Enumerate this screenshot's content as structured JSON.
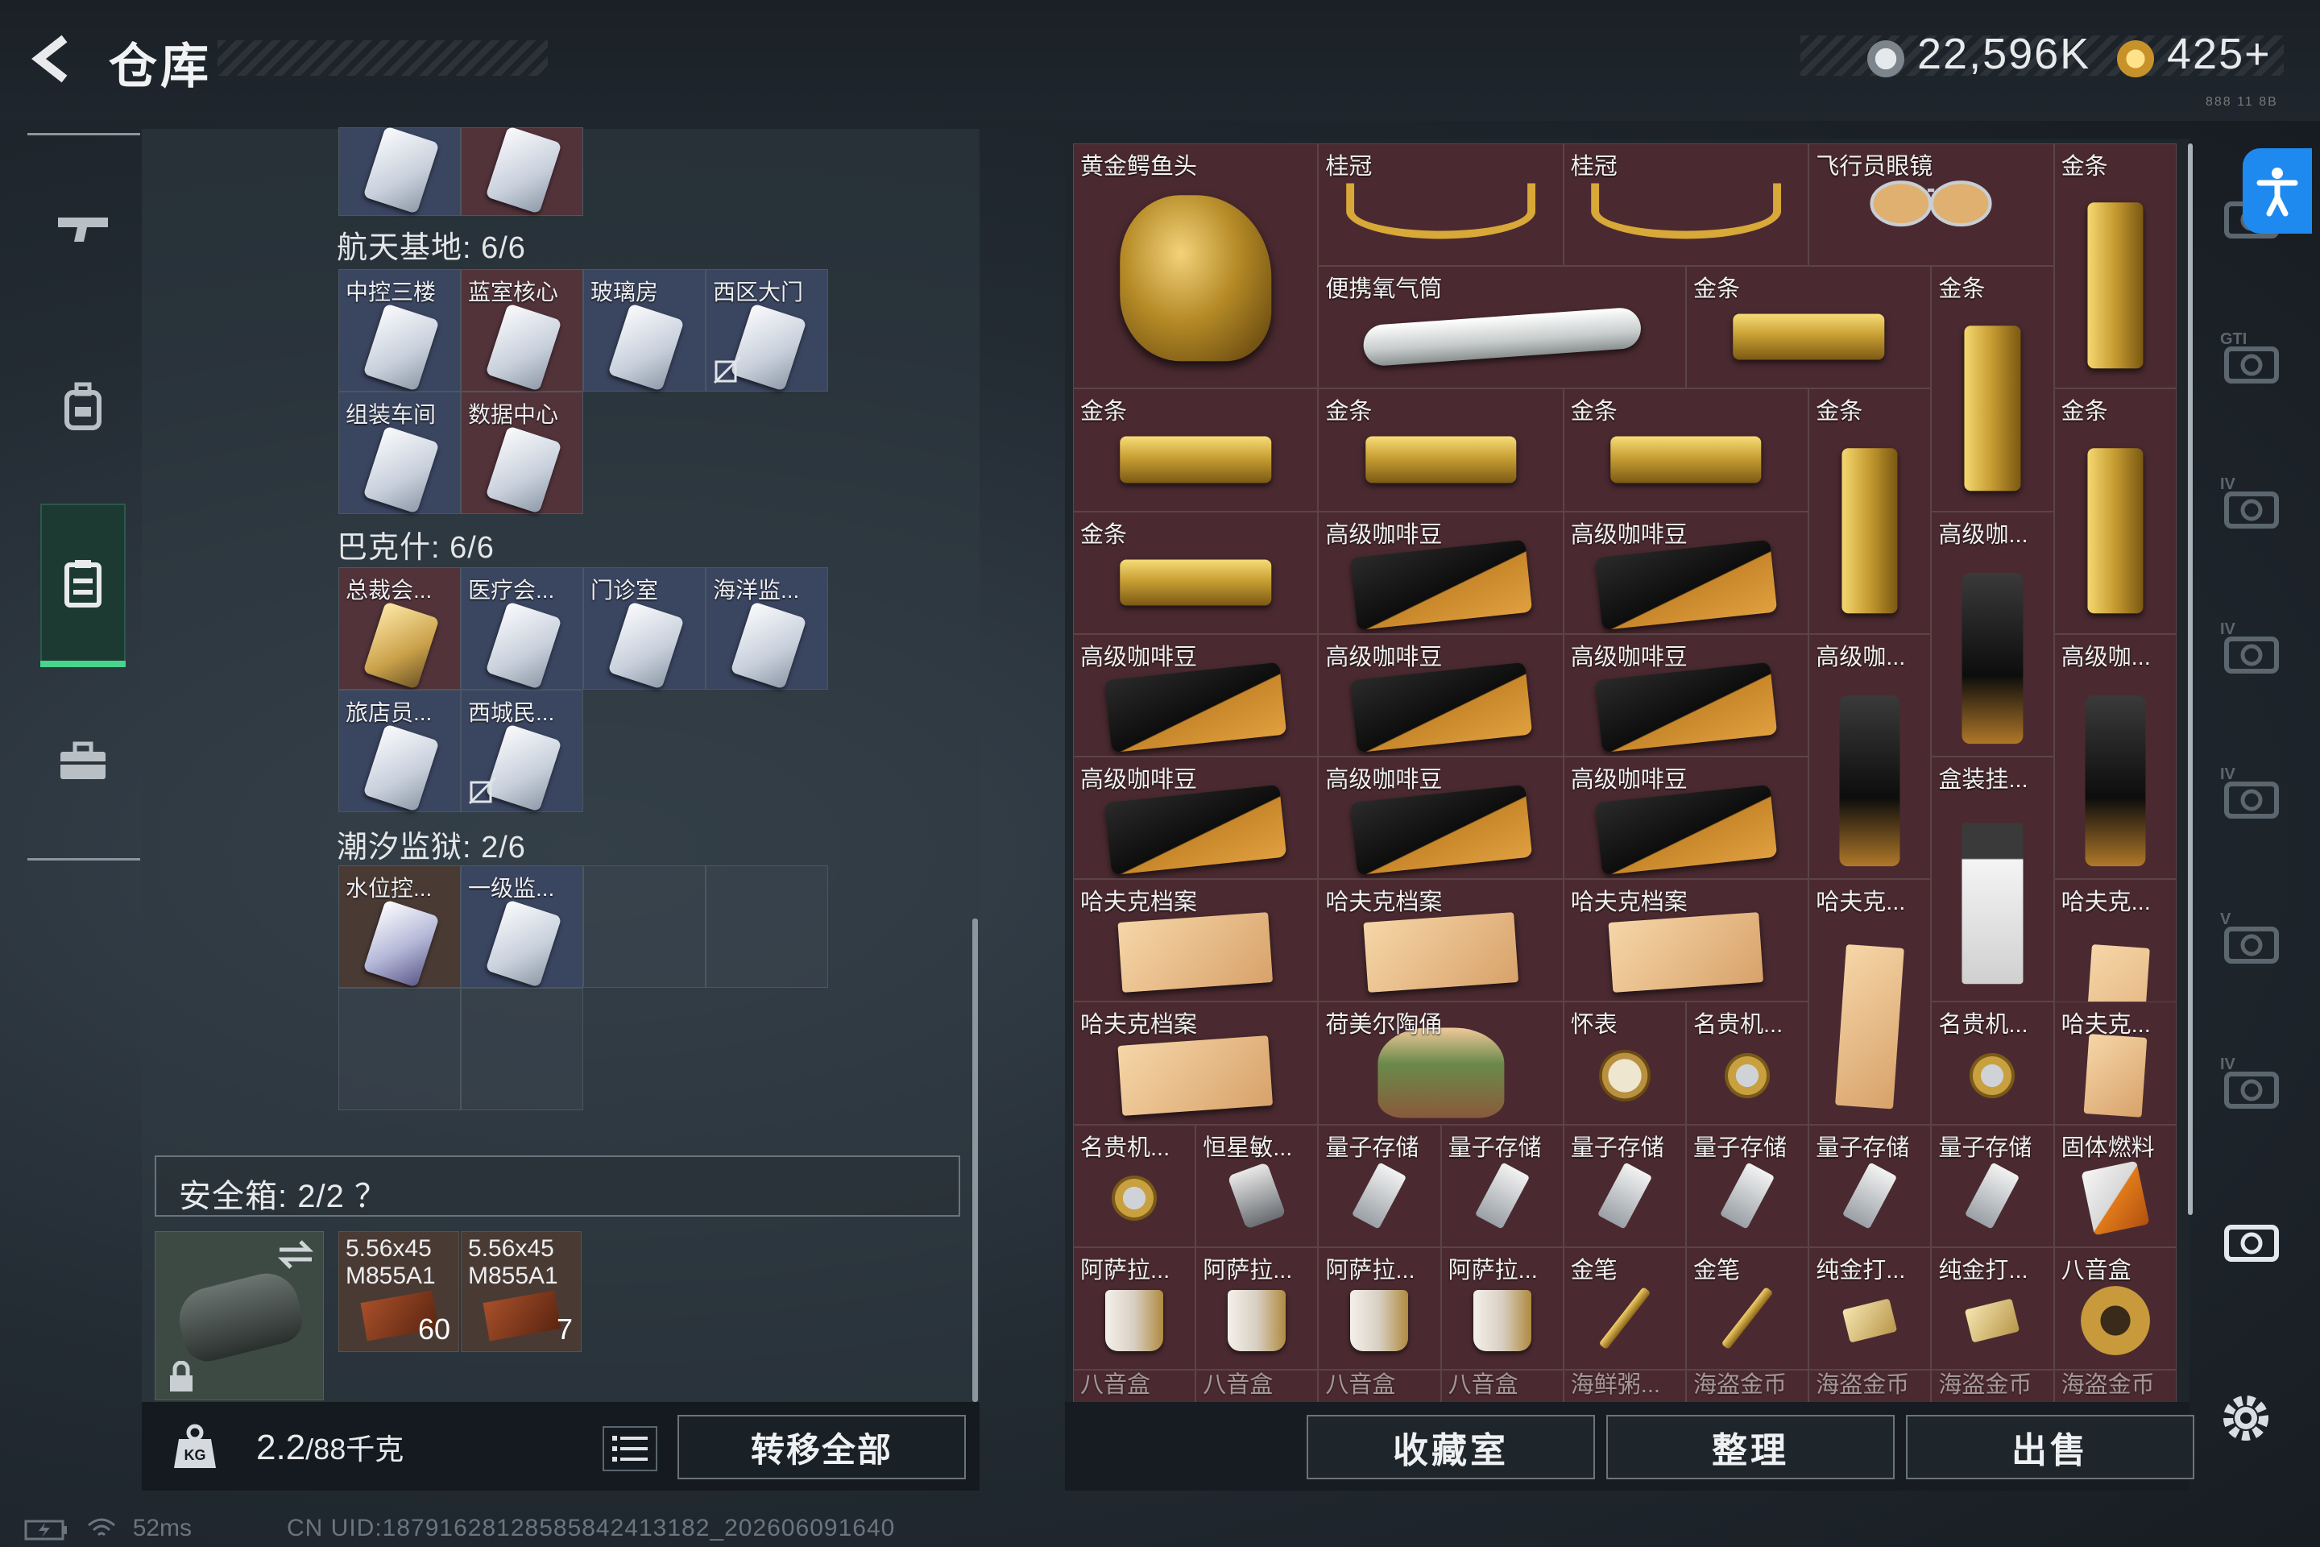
{
  "header": {
    "title": "仓库",
    "sub": "888 11 8B"
  },
  "currency": [
    {
      "name": "coin-icon",
      "value": "22,596K"
    },
    {
      "name": "gem-icon",
      "value": "425+"
    }
  ],
  "left_nav": [
    "gun-icon",
    "backpack-icon",
    "storage-icon",
    "briefcase-icon"
  ],
  "left_sections": [
    {
      "title": "航天基地: 6/6"
    },
    {
      "title": "巴克什: 6/6"
    },
    {
      "title": "潮汐监狱: 2/6"
    }
  ],
  "keycards": {
    "aerospace": [
      "中控三楼",
      "蓝室核心",
      "玻璃房",
      "西区大门",
      "组装车间",
      "数据中心"
    ],
    "bakesh": [
      "总裁会...",
      "医疗会...",
      "门诊室",
      "海洋监...",
      "旅店员...",
      "西城民..."
    ],
    "prison": [
      "水位控...",
      "一级监..."
    ]
  },
  "safe_box": {
    "label": "安全箱: 2/2 ？"
  },
  "safe_items": [
    {
      "label": "5.56x45 M855A1",
      "count": "60"
    },
    {
      "label": "5.56x45 M855A1",
      "count": "7"
    }
  ],
  "weight": {
    "value": "2.2",
    "max": "/88千克"
  },
  "buttons": {
    "transfer_all": "转移全部",
    "collection": "收藏室",
    "sort": "整理",
    "sell": "出售"
  },
  "status": {
    "ping": "52ms",
    "uid": "CN UID:18791628128585842413182_202606091640"
  },
  "items": [
    {
      "label": "黄金鳄鱼头",
      "art": "croc",
      "theme": "r"
    },
    {
      "label": "桂冠",
      "art": "laurel",
      "theme": "r"
    },
    {
      "label": "桂冠",
      "art": "laurel",
      "theme": "r"
    },
    {
      "label": "飞行员眼镜",
      "art": "glasses",
      "theme": "r"
    },
    {
      "label": "金条",
      "art": "gold-v",
      "theme": "r"
    },
    {
      "label": "便携氧气筒",
      "art": "oxygen",
      "theme": "r"
    },
    {
      "label": "金条",
      "art": "gold-h",
      "theme": "r"
    },
    {
      "label": "金条",
      "art": "gold-v",
      "theme": "r"
    },
    {
      "label": "金条",
      "art": "gold-h",
      "theme": "r"
    },
    {
      "label": "金条",
      "art": "gold-h",
      "theme": "r"
    },
    {
      "label": "金条",
      "art": "gold-h",
      "theme": "r"
    },
    {
      "label": "金条",
      "art": "gold-v",
      "theme": "r"
    },
    {
      "label": "金条",
      "art": "gold-v",
      "theme": "r"
    },
    {
      "label": "金条",
      "art": "gold-h",
      "theme": "r"
    },
    {
      "label": "高级咖啡豆",
      "art": "coffee",
      "theme": "r"
    },
    {
      "label": "高级咖啡豆",
      "art": "coffee",
      "theme": "r"
    },
    {
      "label": "高级咖...",
      "art": "coffee-v",
      "theme": "r"
    },
    {
      "label": "高级咖啡豆",
      "art": "coffee",
      "theme": "r"
    },
    {
      "label": "高级咖啡豆",
      "art": "coffee",
      "theme": "r"
    },
    {
      "label": "高级咖啡豆",
      "art": "coffee",
      "theme": "r"
    },
    {
      "label": "高级咖...",
      "art": "coffee-v",
      "theme": "r"
    },
    {
      "label": "高级咖...",
      "art": "coffee-v",
      "theme": "r"
    },
    {
      "label": "高级咖啡豆",
      "art": "coffee",
      "theme": "r"
    },
    {
      "label": "高级咖啡豆",
      "art": "coffee",
      "theme": "r"
    },
    {
      "label": "高级咖啡豆",
      "art": "coffee",
      "theme": "r"
    },
    {
      "label": "盒装挂...",
      "art": "barista",
      "theme": "r"
    },
    {
      "label": "哈夫克档案",
      "art": "file",
      "theme": "r"
    },
    {
      "label": "哈夫克档案",
      "art": "file",
      "theme": "r"
    },
    {
      "label": "哈夫克档案",
      "art": "file",
      "theme": "r"
    },
    {
      "label": "哈夫克...",
      "art": "file-v",
      "theme": "r"
    },
    {
      "label": "哈夫克...",
      "art": "file-v",
      "theme": "r"
    },
    {
      "label": "哈夫克档案",
      "art": "file",
      "theme": "r"
    },
    {
      "label": "荷美尔陶俑",
      "art": "figure",
      "theme": "r"
    },
    {
      "label": "怀表",
      "art": "compass",
      "theme": "r"
    },
    {
      "label": "名贵机...",
      "art": "watch",
      "theme": "r"
    },
    {
      "label": "哈夫克...",
      "art": "file-v",
      "theme": "r"
    },
    {
      "label": "名贵机...",
      "art": "watch",
      "theme": "r"
    },
    {
      "label": "名贵机...",
      "art": "watch",
      "theme": "r"
    },
    {
      "label": "恒星敏...",
      "art": "sensor",
      "theme": "r"
    },
    {
      "label": "量子存储",
      "art": "usb",
      "theme": "r"
    },
    {
      "label": "量子存储",
      "art": "usb",
      "theme": "r"
    },
    {
      "label": "量子存储",
      "art": "usb",
      "theme": "r"
    },
    {
      "label": "量子存储",
      "art": "usb",
      "theme": "r"
    },
    {
      "label": "量子存储",
      "art": "usb",
      "theme": "r"
    },
    {
      "label": "量子存储",
      "art": "usb",
      "theme": "r"
    },
    {
      "label": "固体燃料",
      "art": "fuel",
      "theme": "r"
    },
    {
      "label": "阿萨拉...",
      "art": "mug",
      "theme": "r"
    },
    {
      "label": "阿萨拉...",
      "art": "mug",
      "theme": "r"
    },
    {
      "label": "阿萨拉...",
      "art": "mug",
      "theme": "r"
    },
    {
      "label": "阿萨拉...",
      "art": "mug",
      "theme": "r"
    },
    {
      "label": "金笔",
      "art": "pen",
      "theme": "r"
    },
    {
      "label": "金笔",
      "art": "pen",
      "theme": "r"
    },
    {
      "label": "纯金打...",
      "art": "lighter",
      "theme": "r"
    },
    {
      "label": "纯金打...",
      "art": "lighter",
      "theme": "r"
    },
    {
      "label": "八音盒",
      "art": "musicbox",
      "theme": "r"
    },
    {
      "label": "八音盒",
      "art": "",
      "theme": "r"
    },
    {
      "label": "八音盒",
      "art": "",
      "theme": "r"
    },
    {
      "label": "八音盒",
      "art": "",
      "theme": "r"
    },
    {
      "label": "八音盒",
      "art": "",
      "theme": "r"
    },
    {
      "label": "海鲜粥...",
      "art": "",
      "theme": "r"
    },
    {
      "label": "海盗金币",
      "art": "",
      "theme": "r"
    },
    {
      "label": "海盗金币",
      "art": "",
      "theme": "r"
    },
    {
      "label": "海盗金币",
      "art": "",
      "theme": "r"
    },
    {
      "label": "海盗金币",
      "art": "",
      "theme": "r"
    }
  ],
  "right_rail": [
    "home-icon",
    "gti-tag-icon",
    "iv-tag-icon",
    "iv-folder-icon",
    "iv-plus-icon",
    "v-cam-icon",
    "iv-cam2-icon",
    "camera-icon"
  ],
  "colors": {
    "accent_green": "#47d48c",
    "item_bg": "#4a2a30",
    "blue_btn": "#1e8af0"
  }
}
